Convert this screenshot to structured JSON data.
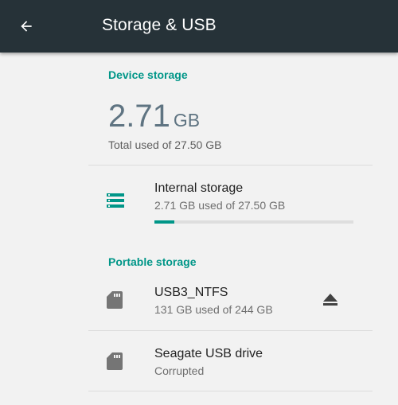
{
  "appbar": {
    "title": "Storage & USB",
    "back_icon": "arrow-back-icon",
    "background": "#263238"
  },
  "device_storage": {
    "header": "Device storage",
    "used_number": "2.71",
    "used_unit": "GB",
    "summary": "Total used of 27.50 GB",
    "items": [
      {
        "title": "Internal storage",
        "subtitle": "2.71 GB used of 27.50 GB",
        "icon": "storage-icon",
        "used_fraction": 0.0985
      }
    ]
  },
  "portable_storage": {
    "header": "Portable storage",
    "items": [
      {
        "title": "USB3_NTFS",
        "subtitle": "131 GB used of 244 GB",
        "icon": "sd-card-icon",
        "action_icon": "eject-icon"
      },
      {
        "title": "Seagate USB drive",
        "subtitle": "Corrupted",
        "icon": "sd-card-icon"
      }
    ]
  },
  "colors": {
    "accent": "#009688",
    "icon_grey": "#757575"
  }
}
